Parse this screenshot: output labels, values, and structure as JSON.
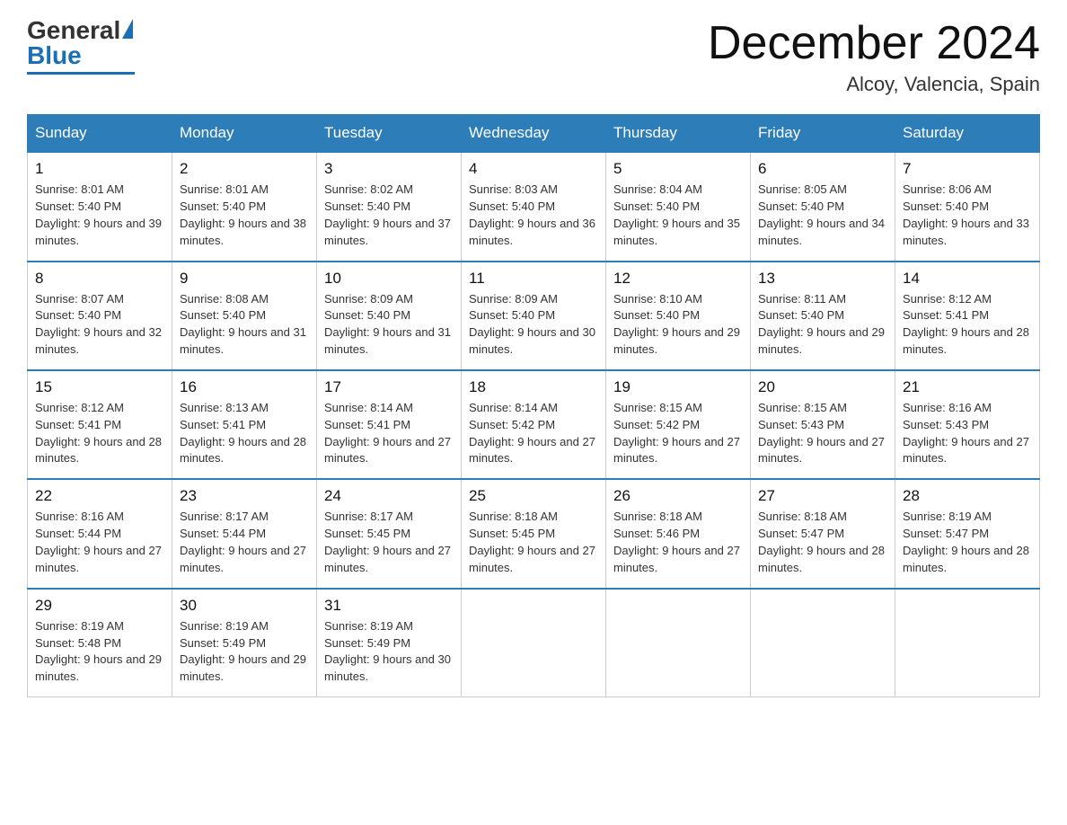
{
  "header": {
    "logo_general": "General",
    "logo_blue": "Blue",
    "month_title": "December 2024",
    "location": "Alcoy, Valencia, Spain"
  },
  "days_of_week": [
    "Sunday",
    "Monday",
    "Tuesday",
    "Wednesday",
    "Thursday",
    "Friday",
    "Saturday"
  ],
  "weeks": [
    [
      {
        "day": "1",
        "sunrise": "8:01 AM",
        "sunset": "5:40 PM",
        "daylight": "9 hours and 39 minutes."
      },
      {
        "day": "2",
        "sunrise": "8:01 AM",
        "sunset": "5:40 PM",
        "daylight": "9 hours and 38 minutes."
      },
      {
        "day": "3",
        "sunrise": "8:02 AM",
        "sunset": "5:40 PM",
        "daylight": "9 hours and 37 minutes."
      },
      {
        "day": "4",
        "sunrise": "8:03 AM",
        "sunset": "5:40 PM",
        "daylight": "9 hours and 36 minutes."
      },
      {
        "day": "5",
        "sunrise": "8:04 AM",
        "sunset": "5:40 PM",
        "daylight": "9 hours and 35 minutes."
      },
      {
        "day": "6",
        "sunrise": "8:05 AM",
        "sunset": "5:40 PM",
        "daylight": "9 hours and 34 minutes."
      },
      {
        "day": "7",
        "sunrise": "8:06 AM",
        "sunset": "5:40 PM",
        "daylight": "9 hours and 33 minutes."
      }
    ],
    [
      {
        "day": "8",
        "sunrise": "8:07 AM",
        "sunset": "5:40 PM",
        "daylight": "9 hours and 32 minutes."
      },
      {
        "day": "9",
        "sunrise": "8:08 AM",
        "sunset": "5:40 PM",
        "daylight": "9 hours and 31 minutes."
      },
      {
        "day": "10",
        "sunrise": "8:09 AM",
        "sunset": "5:40 PM",
        "daylight": "9 hours and 31 minutes."
      },
      {
        "day": "11",
        "sunrise": "8:09 AM",
        "sunset": "5:40 PM",
        "daylight": "9 hours and 30 minutes."
      },
      {
        "day": "12",
        "sunrise": "8:10 AM",
        "sunset": "5:40 PM",
        "daylight": "9 hours and 29 minutes."
      },
      {
        "day": "13",
        "sunrise": "8:11 AM",
        "sunset": "5:40 PM",
        "daylight": "9 hours and 29 minutes."
      },
      {
        "day": "14",
        "sunrise": "8:12 AM",
        "sunset": "5:41 PM",
        "daylight": "9 hours and 28 minutes."
      }
    ],
    [
      {
        "day": "15",
        "sunrise": "8:12 AM",
        "sunset": "5:41 PM",
        "daylight": "9 hours and 28 minutes."
      },
      {
        "day": "16",
        "sunrise": "8:13 AM",
        "sunset": "5:41 PM",
        "daylight": "9 hours and 28 minutes."
      },
      {
        "day": "17",
        "sunrise": "8:14 AM",
        "sunset": "5:41 PM",
        "daylight": "9 hours and 27 minutes."
      },
      {
        "day": "18",
        "sunrise": "8:14 AM",
        "sunset": "5:42 PM",
        "daylight": "9 hours and 27 minutes."
      },
      {
        "day": "19",
        "sunrise": "8:15 AM",
        "sunset": "5:42 PM",
        "daylight": "9 hours and 27 minutes."
      },
      {
        "day": "20",
        "sunrise": "8:15 AM",
        "sunset": "5:43 PM",
        "daylight": "9 hours and 27 minutes."
      },
      {
        "day": "21",
        "sunrise": "8:16 AM",
        "sunset": "5:43 PM",
        "daylight": "9 hours and 27 minutes."
      }
    ],
    [
      {
        "day": "22",
        "sunrise": "8:16 AM",
        "sunset": "5:44 PM",
        "daylight": "9 hours and 27 minutes."
      },
      {
        "day": "23",
        "sunrise": "8:17 AM",
        "sunset": "5:44 PM",
        "daylight": "9 hours and 27 minutes."
      },
      {
        "day": "24",
        "sunrise": "8:17 AM",
        "sunset": "5:45 PM",
        "daylight": "9 hours and 27 minutes."
      },
      {
        "day": "25",
        "sunrise": "8:18 AM",
        "sunset": "5:45 PM",
        "daylight": "9 hours and 27 minutes."
      },
      {
        "day": "26",
        "sunrise": "8:18 AM",
        "sunset": "5:46 PM",
        "daylight": "9 hours and 27 minutes."
      },
      {
        "day": "27",
        "sunrise": "8:18 AM",
        "sunset": "5:47 PM",
        "daylight": "9 hours and 28 minutes."
      },
      {
        "day": "28",
        "sunrise": "8:19 AM",
        "sunset": "5:47 PM",
        "daylight": "9 hours and 28 minutes."
      }
    ],
    [
      {
        "day": "29",
        "sunrise": "8:19 AM",
        "sunset": "5:48 PM",
        "daylight": "9 hours and 29 minutes."
      },
      {
        "day": "30",
        "sunrise": "8:19 AM",
        "sunset": "5:49 PM",
        "daylight": "9 hours and 29 minutes."
      },
      {
        "day": "31",
        "sunrise": "8:19 AM",
        "sunset": "5:49 PM",
        "daylight": "9 hours and 30 minutes."
      },
      null,
      null,
      null,
      null
    ]
  ]
}
